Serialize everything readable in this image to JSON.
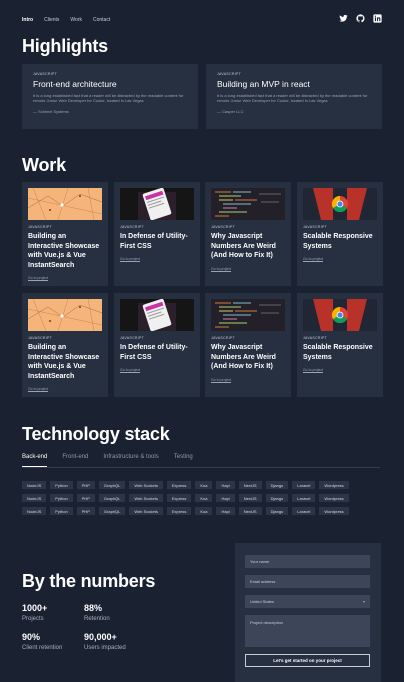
{
  "nav": {
    "items": [
      "Intro",
      "Clients",
      "Work",
      "Contact"
    ]
  },
  "social": [
    "twitter-icon",
    "github-icon",
    "linkedin-icon"
  ],
  "highlights": {
    "title": "Highlights",
    "cards": [
      {
        "category": "JAVASCRIPT",
        "title": "Front-end architecture",
        "description": "It is a long established fact that a reader will be distracted by the readable content for remote Junior Web Developer for Coolor, located in Las Vegas",
        "author": "— Schimel Systems"
      },
      {
        "category": "JAVASCRIPT",
        "title": "Building an MVP in react",
        "description": "It is a long established fact that a reader will be distracted by the readable content for remote Junior Web Developer for Coolor, located in Las Vegas",
        "author": "— Casper LLC"
      }
    ]
  },
  "work": {
    "title": "Work",
    "cards": [
      {
        "category": "JAVASCRIPT",
        "title": "Building an Interactive Showcase with Vue.js & Vue InstantSearch",
        "link": "Go to project",
        "thumb": "map"
      },
      {
        "category": "JAVASCRIPT",
        "title": "In Defense of Utility-First CSS",
        "link": "Go to project",
        "thumb": "phone"
      },
      {
        "category": "JAVASCRIPT",
        "title": "Why Javascript Numbers Are Weird (And How to Fix It)",
        "link": "Go to project",
        "thumb": "code"
      },
      {
        "category": "JAVASCRIPT",
        "title": "Scalable Responsive Systems",
        "link": "Go to project",
        "thumb": "chrome"
      },
      {
        "category": "JAVASCRIPT",
        "title": "Building an Interactive Showcase with Vue.js & Vue InstantSearch",
        "link": "Go to project",
        "thumb": "map"
      },
      {
        "category": "JAVASCRIPT",
        "title": "In Defense of Utility-First CSS",
        "link": "Go to project",
        "thumb": "phone"
      },
      {
        "category": "JAVASCRIPT",
        "title": "Why Javascript Numbers Are Weird (And How to Fix It)",
        "link": "Go to project",
        "thumb": "code"
      },
      {
        "category": "JAVASCRIPT",
        "title": "Scalable Responsive Systems",
        "link": "Go to project",
        "thumb": "chrome"
      }
    ]
  },
  "tech": {
    "title": "Technology stack",
    "tabs": [
      "Back-end",
      "Front-end",
      "Infrastructure & tools",
      "Testing"
    ],
    "active_tab": 0,
    "chip_rows": [
      [
        "NodeJS",
        "Python",
        "PHP",
        "GraphQL",
        "Web Sockets",
        "Express",
        "Koa",
        "Hapi",
        "NextJS",
        "Django",
        "Laravel",
        "Wordpress"
      ],
      [
        "NodeJS",
        "Python",
        "PHP",
        "GraphQL",
        "Web Sockets",
        "Express",
        "Koa",
        "Hapi",
        "NextJS",
        "Django",
        "Laravel",
        "Wordpress"
      ],
      [
        "NodeJS",
        "Python",
        "PHP",
        "GraphQL",
        "Web Sockets",
        "Express",
        "Koa",
        "Hapi",
        "NextJS",
        "Django",
        "Laravel",
        "Wordpress"
      ]
    ]
  },
  "numbers": {
    "title": "By the numbers",
    "stats": [
      {
        "value": "1000+",
        "label": "Projects"
      },
      {
        "value": "88%",
        "label": "Retention"
      },
      {
        "value": "90%",
        "label": "Client retention"
      },
      {
        "value": "90,000+",
        "label": "Users impacted"
      }
    ]
  },
  "form": {
    "name_placeholder": "Your name",
    "email_placeholder": "Email address",
    "country_value": "United States",
    "description_placeholder": "Project description",
    "submit_label": "Let's get started on your project"
  },
  "colors": {
    "background": "#1a2130",
    "card": "#263041",
    "field": "#3c4658"
  }
}
